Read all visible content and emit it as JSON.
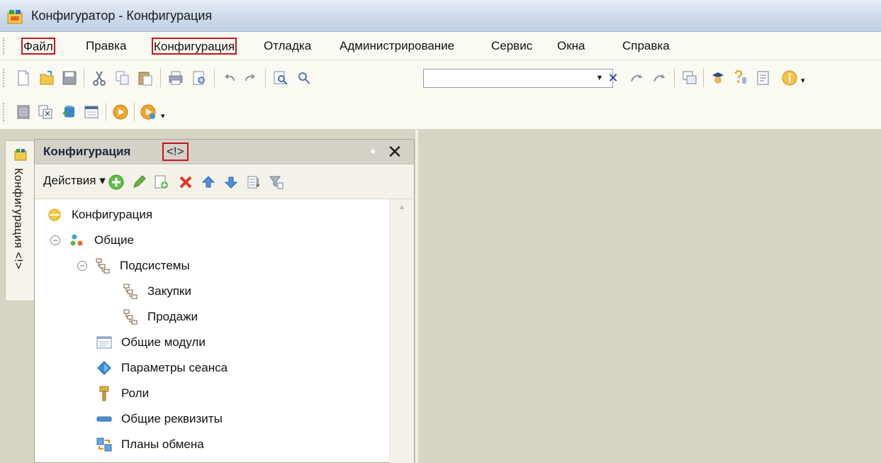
{
  "window": {
    "title": "Конфигуратор - Конфигурация"
  },
  "menu": {
    "items": [
      {
        "label": "Файл",
        "highlighted": true
      },
      {
        "label": "Правка",
        "highlighted": false
      },
      {
        "label": "Конфигурация",
        "highlighted": true
      },
      {
        "label": "Отладка",
        "highlighted": false
      },
      {
        "label": "Администрирование",
        "highlighted": false
      },
      {
        "label": "Сервис",
        "highlighted": false
      },
      {
        "label": "Окна",
        "highlighted": false
      },
      {
        "label": "Справка",
        "highlighted": false
      }
    ]
  },
  "toolbar": {
    "search_value": "",
    "icons": [
      "new-document-icon",
      "open-icon",
      "save-icon",
      "cut-icon",
      "copy-icon",
      "paste-icon",
      "print-icon",
      "print-preview-icon",
      "undo-icon",
      "redo-icon",
      "find-in-files-icon",
      "find-icon",
      "search-next-icon",
      "search-prev-icon",
      "windows-icon",
      "assistant-icon",
      "syntax-helper-icon",
      "calendar-icon",
      "info-icon"
    ]
  },
  "toolbar2": {
    "icons": [
      "db-config-icon",
      "compare-icon",
      "db-update-icon",
      "window-list-icon",
      "run-icon",
      "debug-run-icon"
    ]
  },
  "sidebar": {
    "tab_label": "Конфигурация <!>"
  },
  "panel": {
    "title": "Конфигурация",
    "mark": "<!>",
    "actions_label": "Действия"
  },
  "tree": {
    "items": [
      {
        "label": "Конфигурация",
        "icon": "config-root-icon"
      },
      {
        "label": "Общие",
        "icon": "common-icon"
      },
      {
        "label": "Подсистемы",
        "icon": "subsystems-icon"
      },
      {
        "label": "Закупки",
        "icon": "subsystem-icon"
      },
      {
        "label": "Продажи",
        "icon": "subsystem-icon"
      },
      {
        "label": "Общие модули",
        "icon": "module-icon"
      },
      {
        "label": "Параметры сеанса",
        "icon": "session-param-icon"
      },
      {
        "label": "Роли",
        "icon": "role-icon"
      },
      {
        "label": "Общие реквизиты",
        "icon": "attribute-icon"
      },
      {
        "label": "Планы обмена",
        "icon": "exchange-plan-icon"
      }
    ]
  },
  "colors": {
    "highlight": "#c5151c",
    "panel_header": "#d4d2c6",
    "workspace": "#d9d5c4"
  }
}
